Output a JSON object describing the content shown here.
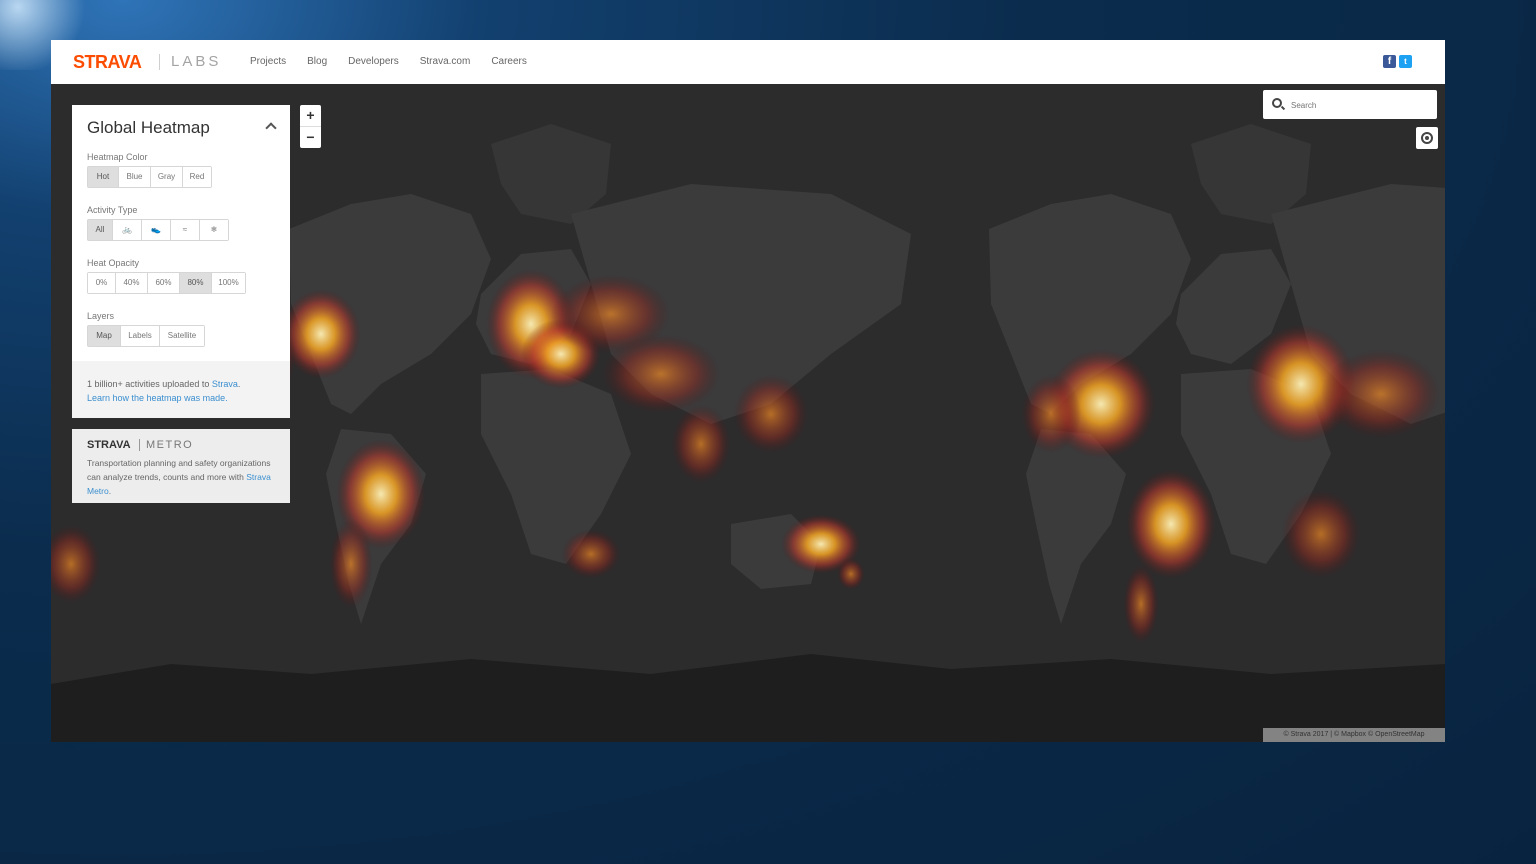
{
  "header": {
    "brand": "STRAVA",
    "sub_brand": "LABS",
    "nav": [
      "Projects",
      "Blog",
      "Developers",
      "Strava.com",
      "Careers"
    ],
    "social": [
      {
        "icon": "facebook-icon",
        "glyph": "f"
      },
      {
        "icon": "twitter-icon",
        "glyph": "t"
      }
    ]
  },
  "search": {
    "placeholder": "Search"
  },
  "zoom": {
    "in": "+",
    "out": "−"
  },
  "panel": {
    "title": "Global Heatmap",
    "heatmap_color": {
      "label": "Heatmap Color",
      "options": [
        "Hot",
        "Blue",
        "Gray",
        "Red"
      ],
      "selected": "Hot"
    },
    "activity_type": {
      "label": "Activity Type",
      "options": [
        "All",
        "bike-icon",
        "run-icon",
        "water-icon",
        "winter-icon"
      ],
      "selected": "All"
    },
    "heat_opacity": {
      "label": "Heat Opacity",
      "options": [
        "0%",
        "40%",
        "60%",
        "80%",
        "100%"
      ],
      "selected": "80%"
    },
    "layers": {
      "label": "Layers",
      "options": [
        "Map",
        "Labels",
        "Satellite"
      ],
      "selected": "Map"
    },
    "footer": {
      "line1_prefix": "1 billion+ activities uploaded to ",
      "line1_link": "Strava",
      "line1_suffix": ".",
      "line2_link": "Learn how the heatmap was made."
    }
  },
  "metro": {
    "brand": "STRAVA",
    "title": "METRO",
    "text_prefix": "Transportation planning and safety organizations can analyze trends, counts and more with ",
    "link": "Strava Metro",
    "text_suffix": "."
  },
  "attribution": "© Strava 2017 | © Mapbox © OpenStreetMap",
  "colors": {
    "brand": "#fc4c02",
    "heat_core": "#fff2b8",
    "heat_mid": "#f5a623",
    "heat_outer": "#c0392b",
    "land": "#3a3a3b",
    "ocean": "#2c2c2d"
  }
}
